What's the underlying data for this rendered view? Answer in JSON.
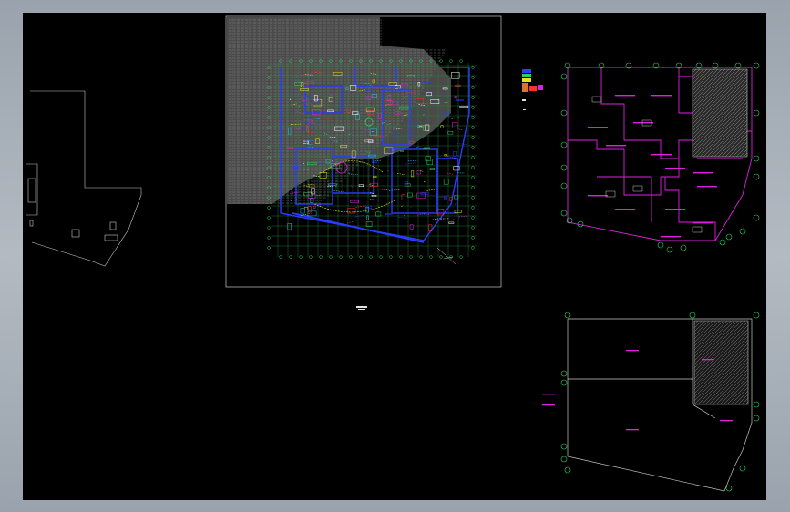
{
  "app": {
    "title": "",
    "view": "Model space"
  },
  "colors": {
    "background": "#000000",
    "frame": "#c8c8c8",
    "grid": "#1f8f3a",
    "grid_bubble": "#2fd05a",
    "wall": "#2a3cff",
    "magenta": "#e020e0",
    "hatch": "#9a9a9a",
    "yellow": "#e6e020",
    "white": "#ffffff",
    "red": "#ff3030",
    "cyan": "#20c8e0"
  },
  "drawings": [
    {
      "name": "site-outline-left",
      "label": ""
    },
    {
      "name": "main-floor-plan",
      "label": ""
    },
    {
      "name": "magenta-zone-plan",
      "label": ""
    },
    {
      "name": "lower-right-plan",
      "label": ""
    }
  ],
  "legend_icons": [
    "blue-block-icon",
    "green-block-icon",
    "yellow-block-icon",
    "red-block-icon"
  ]
}
